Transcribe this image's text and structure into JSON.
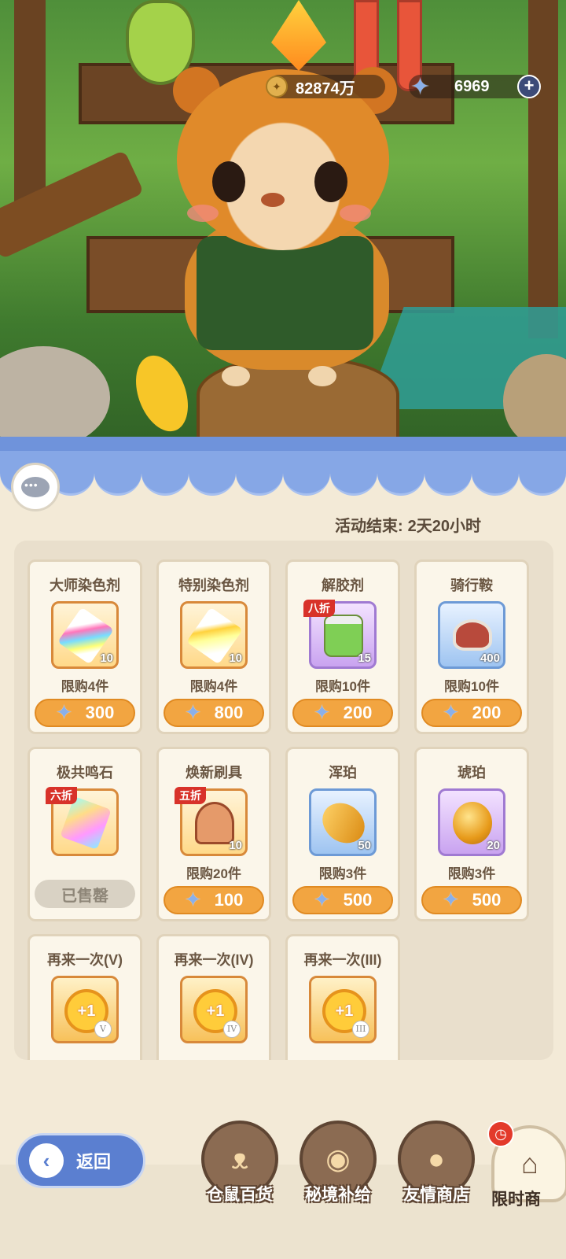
{
  "currency": {
    "gold_icon": "coin-icon",
    "gold_value": "82874万",
    "gem_icon": "star-crystal-icon",
    "gem_value": "6969",
    "add_label": "+"
  },
  "shop": {
    "timer_label": "活动结束:",
    "timer_value": "2天20小时",
    "items": [
      {
        "name": "大师染色剂",
        "icon": "rainbow-dye-tube",
        "qty": "10",
        "limit": "限购4件",
        "price": "300",
        "discount": "",
        "frame": "orange"
      },
      {
        "name": "特别染色剂",
        "icon": "gold-dye-tube",
        "qty": "10",
        "limit": "限购4件",
        "price": "800",
        "discount": "",
        "frame": "orange"
      },
      {
        "name": "解胶剂",
        "icon": "green-solvent-bottle",
        "qty": "15",
        "limit": "限购10件",
        "price": "200",
        "discount": "八折",
        "frame": "purple"
      },
      {
        "name": "骑行鞍",
        "icon": "red-saddle",
        "qty": "400",
        "limit": "限购10件",
        "price": "200",
        "discount": "",
        "frame": "blue"
      },
      {
        "name": "极共鸣石",
        "icon": "prism-stone",
        "qty": "",
        "limit": "",
        "price": "",
        "discount": "六折",
        "frame": "orange",
        "sold_label": "已售罄"
      },
      {
        "name": "焕新刷具",
        "icon": "brush-iron",
        "qty": "10",
        "limit": "限购20件",
        "price": "100",
        "discount": "五折",
        "frame": "orange"
      },
      {
        "name": "浑珀",
        "icon": "raw-amber",
        "qty": "50",
        "limit": "限购3件",
        "price": "500",
        "discount": "",
        "frame": "blue"
      },
      {
        "name": "琥珀",
        "icon": "amber-gem",
        "qty": "20",
        "limit": "限购3件",
        "price": "500",
        "discount": "",
        "frame": "purple"
      },
      {
        "name": "再来一次(V)",
        "icon": "retry-coin",
        "coin_text": "+1",
        "roman": "V",
        "frame": "gold"
      },
      {
        "name": "再来一次(IV)",
        "icon": "retry-coin",
        "coin_text": "+1",
        "roman": "IV",
        "frame": "gold"
      },
      {
        "name": "再来一次(III)",
        "icon": "retry-coin",
        "coin_text": "+1",
        "roman": "III",
        "frame": "gold"
      }
    ]
  },
  "nav": {
    "back_label": "返回",
    "tabs": [
      {
        "label": "仓鼠百货",
        "icon": "hamster-icon"
      },
      {
        "label": "秘境补给",
        "icon": "eye-emblem-icon"
      },
      {
        "label": "友情商店",
        "icon": "crystal-ball-icon"
      },
      {
        "label": "限时商",
        "icon": "shop-stall-icon"
      }
    ],
    "alarm_icon": "clock-alarm-icon"
  },
  "colors": {
    "awning": "#6f93db",
    "price_button": "#f2a541",
    "discount_badge": "#d8322a",
    "back_button": "#5b7fd0"
  }
}
